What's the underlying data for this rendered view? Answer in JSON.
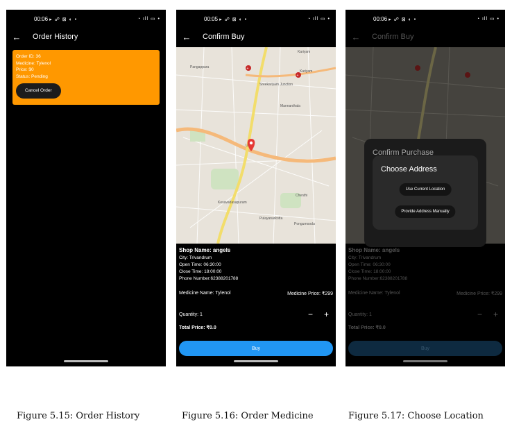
{
  "screens": [
    {
      "status_time": "00:06",
      "title": "Order History",
      "order": {
        "id": "Order ID: 36",
        "medicine": "Medicine: Tylenol",
        "price": "Price: $0",
        "status": "Status: Pending",
        "cancel_label": "Cancel Order"
      }
    },
    {
      "status_time": "00:05",
      "title": "Confirm Buy",
      "map_labels": [
        "Kariyam",
        "Kariyam",
        "Sreekariyam Junction",
        "Pangappara",
        "Chenthi",
        "Pulayanarkotta",
        "Pongumoodu",
        "Ulloor",
        "Kesavadasapuram",
        "Mannanthala"
      ],
      "shop": {
        "name": "Shop Name: angels",
        "city": "City: Trivandrum",
        "open": "Open Time: 06:30:00",
        "close": "Close Time: 18:00:00",
        "phone": "Phone Number:62388201788"
      },
      "medicine_name": "Medicine Name: Tylenol",
      "medicine_price": "Medicine Price: ₹299",
      "quantity": "Quantity: 1",
      "total": "Total Price: ₹0.0",
      "buy_label": "Buy"
    },
    {
      "status_time": "00:06",
      "title": "Confirm Buy",
      "confirm_title": "Confirm Purchase",
      "dialog_title": "Choose Address",
      "current_location_label": "Use Current Location",
      "manual_label": "Provide Address Manually",
      "shop": {
        "name": "Shop Name: angels",
        "city": "City: Trivandrum",
        "open": "Open Time: 06:30:00",
        "close": "Close Time: 18:00:00",
        "phone": "Phone Number:62388201788"
      },
      "medicine_name": "Medicine Name: Tylenol",
      "medicine_price": "Medicine Price: ₹299",
      "quantity": "Quantity: 1",
      "total": "Total Price: ₹0.0",
      "buy_label": "Buy"
    }
  ],
  "captions": [
    "Figure 5.15: Order History",
    "Figure 5.16: Order Medicine",
    "Figure 5.17: Choose Location"
  ],
  "status_icons": "▸ ☍ ⊠ ◐ •",
  "status_right": "◔ ıll ▭ •",
  "colors": {
    "order_card": "#ff9800",
    "buy_button": "#2196f3",
    "map_pin": "#e53935"
  }
}
